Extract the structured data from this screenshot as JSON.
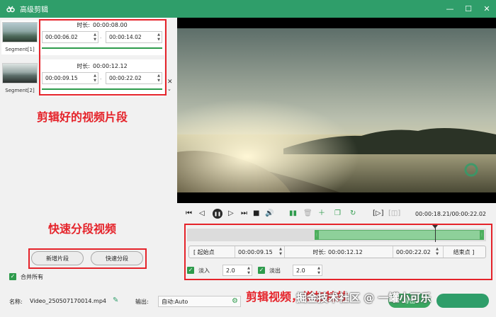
{
  "window": {
    "title": "高级剪辑",
    "controls": {
      "minimize": "—",
      "maximize": "☐",
      "close": "✕"
    },
    "accent_color": "#2f9e6a"
  },
  "segments": {
    "thumbnails": [
      {
        "label": "Segment[1]"
      },
      {
        "label": "Segment[2]"
      }
    ],
    "cards": [
      {
        "duration_label": "时长:",
        "duration": "00:00:08.00",
        "start": "00:00:06.02",
        "end": "00:00:14.02"
      },
      {
        "duration_label": "时长:",
        "duration": "00:00:12.12",
        "start": "00:00:09.15",
        "end": "00:00:22.02"
      }
    ],
    "close_glyph": "✕",
    "collapse_glyph": "⌄"
  },
  "annotations": {
    "segments_caption": "剪辑好的视频片段",
    "quick_split_caption": "快速分段视频",
    "edit_caption": "剪辑视频，增加特效"
  },
  "actions": {
    "add_segment": "新增片段",
    "quick_split": "快速分段",
    "merge_all": "合并所有"
  },
  "player": {
    "timecode": "00:00:18.21/00:00:22.02",
    "icons": [
      "skip-start-icon",
      "step-back-icon",
      "play-icon",
      "step-forward-icon",
      "stop-icon",
      "skip-end-icon",
      "volume-icon",
      "split-icon",
      "delete-icon",
      "add-icon",
      "copy-icon",
      "rotate-icon",
      "crop-icon",
      "snapshot-icon"
    ]
  },
  "trim": {
    "start_btn": "[ 起始点",
    "start_value": "00:00:09.15",
    "duration_label": "时长:",
    "duration_value": "00:00:12.12",
    "end_value": "00:00:22.02",
    "end_btn": "结束点 ]"
  },
  "fade": {
    "fade_in_label": "淡入",
    "fade_in_value": "2.0",
    "fade_out_label": "淡出",
    "fade_out_value": "2.0"
  },
  "bottom": {
    "name_label": "名称:",
    "name_value": "Video_250507170014.mp4",
    "output_label": "输出:",
    "output_value": "自动:Auto",
    "export_label": "导出"
  },
  "watermark": "掘金技术社区 @ 一罐小可乐"
}
